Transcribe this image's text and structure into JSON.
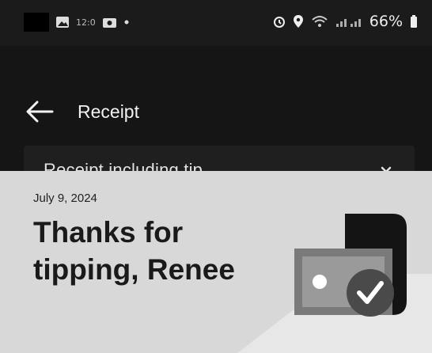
{
  "status_bar": {
    "mini_text": "12:0",
    "battery": "66%",
    "icons": [
      "gallery-icon",
      "camera-icon",
      "alarm-icon",
      "location-icon",
      "wifi-icon",
      "signal-icon",
      "battery-icon"
    ]
  },
  "header": {
    "title": "Receipt",
    "back_icon": "back-arrow-icon"
  },
  "receipt_select": {
    "selected": "Receipt including tip",
    "chevron_icon": "chevron-down-icon"
  },
  "content": {
    "date": "July 9, 2024",
    "heading_line1": "Thanks for",
    "heading_line2": "tipping, Renee",
    "illustration_icon": "cash-check-icon"
  },
  "colors": {
    "status_bar": "#1b1b1b",
    "app_bar": "#151515",
    "content_bg": "#d8d8d8",
    "text_dark": "#1a1a1a"
  }
}
